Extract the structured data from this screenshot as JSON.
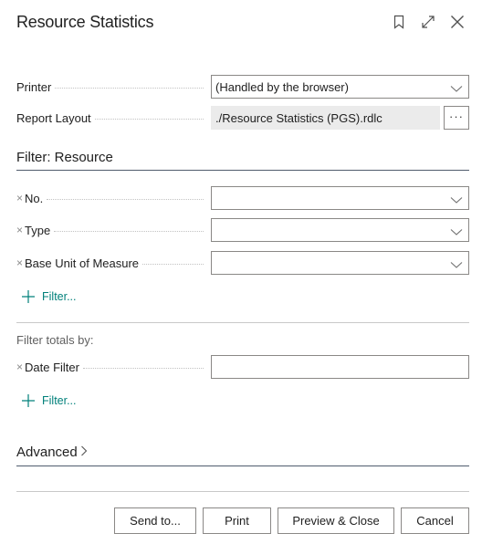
{
  "dialog": {
    "title": "Resource Statistics",
    "icons": [
      "bookmark-icon",
      "expand-icon",
      "close-icon"
    ]
  },
  "options": {
    "printer": {
      "label": "Printer",
      "value": "(Handled by the browser)"
    },
    "report_layout": {
      "label": "Report Layout",
      "value": "./Resource Statistics (PGS).rdlc",
      "lookup_label": "···"
    }
  },
  "filter_resource": {
    "heading": "Filter: Resource",
    "fields": [
      {
        "label": "No.",
        "value": ""
      },
      {
        "label": "Type",
        "value": ""
      },
      {
        "label": "Base Unit of Measure",
        "value": ""
      }
    ],
    "add_filter_label": "Filter..."
  },
  "filter_totals": {
    "heading": "Filter totals by:",
    "fields": [
      {
        "label": "Date Filter",
        "value": ""
      }
    ],
    "add_filter_label": "Filter..."
  },
  "advanced": {
    "label": "Advanced",
    "chevron": "›"
  },
  "footer": {
    "send_to": "Send to...",
    "print": "Print",
    "preview_close": "Preview & Close",
    "cancel": "Cancel"
  },
  "remove_glyph": "×"
}
